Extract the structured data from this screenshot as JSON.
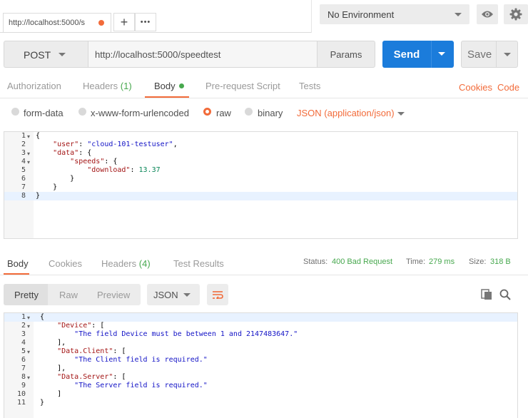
{
  "tab": {
    "url": "http://localhost:5000/s",
    "unsaved_dot_color": "#f26b3a"
  },
  "top_buttons": {
    "add": "+",
    "more": "•••"
  },
  "environment": {
    "selected": "No Environment"
  },
  "request": {
    "method": "POST",
    "url": "http://localhost:5000/speedtest",
    "params_label": "Params",
    "send_label": "Send",
    "save_label": "Save"
  },
  "request_tabs": {
    "authorization": "Authorization",
    "headers": "Headers",
    "headers_count": "(1)",
    "body": "Body",
    "prerequest": "Pre-request Script",
    "tests": "Tests",
    "cookies": "Cookies",
    "code": "Code"
  },
  "body_types": {
    "form_data": "form-data",
    "urlencoded": "x-www-form-urlencoded",
    "raw": "raw",
    "binary": "binary",
    "content_type": "JSON (application/json)"
  },
  "request_body": {
    "line_numbers": [
      "1",
      "2",
      "3",
      "4",
      "5",
      "6",
      "7",
      "8"
    ],
    "lines": [
      "{",
      "    \"user\": \"cloud-101-testuser\",",
      "    \"data\": {",
      "        \"speeds\": {",
      "            \"download\": 13.37",
      "        }",
      "    }",
      "}"
    ]
  },
  "response_tabs": {
    "body": "Body",
    "cookies": "Cookies",
    "headers": "Headers",
    "headers_count": "(4)",
    "test_results": "Test Results"
  },
  "response_status": {
    "status_label": "Status:",
    "status_value": "400 Bad Request",
    "time_label": "Time:",
    "time_value": "279 ms",
    "size_label": "Size:",
    "size_value": "318 B"
  },
  "response_view": {
    "pretty": "Pretty",
    "raw": "Raw",
    "preview": "Preview",
    "language": "JSON"
  },
  "response_body": {
    "line_numbers": [
      "1",
      "2",
      "3",
      "4",
      "5",
      "6",
      "7",
      "8",
      "9",
      "10",
      "11"
    ],
    "lines": [
      "{",
      "    \"Device\": [",
      "        \"The field Device must be between 1 and 2147483647.\"",
      "    ],",
      "    \"Data.Client\": [",
      "        \"The Client field is required.\"",
      "    ],",
      "    \"Data.Server\": [",
      "        \"The Server field is required.\"",
      "    ]",
      "}"
    ]
  },
  "colors": {
    "accent": "#f26b3a",
    "send": "#1b7cdb",
    "success_green": "#47a84e"
  }
}
